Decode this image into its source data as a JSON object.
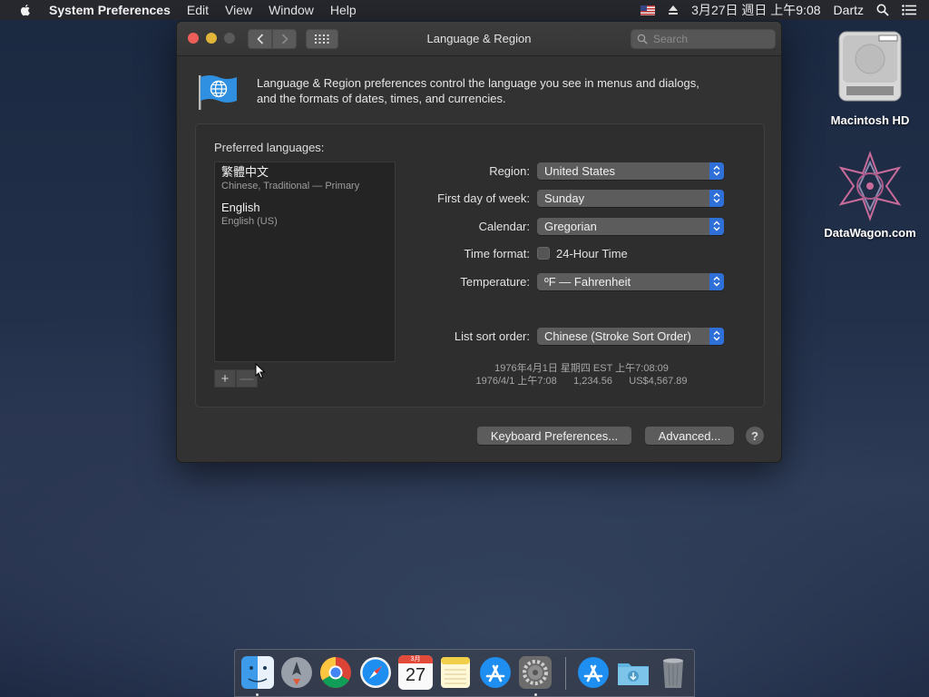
{
  "menubar": {
    "app_name": "System Preferences",
    "menus": [
      "Edit",
      "View",
      "Window",
      "Help"
    ],
    "clock": "3月27日 週日 上午9:08",
    "user": "Dartz"
  },
  "window": {
    "title": "Language & Region",
    "search_placeholder": "Search",
    "description_line1": "Language & Region preferences control the language you see in menus and dialogs,",
    "description_line2": "and the formats of dates, times, and currencies."
  },
  "languages": {
    "label": "Preferred languages:",
    "items": [
      {
        "name": "繁體中文",
        "detail": "Chinese, Traditional — Primary"
      },
      {
        "name": "English",
        "detail": "English (US)"
      }
    ],
    "add_label": "+",
    "remove_label": "—"
  },
  "settings": {
    "region": {
      "label": "Region:",
      "value": "United States"
    },
    "first_day": {
      "label": "First day of week:",
      "value": "Sunday"
    },
    "calendar": {
      "label": "Calendar:",
      "value": "Gregorian"
    },
    "time_format": {
      "label": "Time format:",
      "checkbox_label": "24-Hour Time",
      "checked": false
    },
    "temperature": {
      "label": "Temperature:",
      "value": "ºF — Fahrenheit"
    },
    "list_sort": {
      "label": "List sort order:",
      "value": "Chinese (Stroke Sort Order)"
    }
  },
  "samples": {
    "line1": "1976年4月1日 星期四 EST 上午7:08:09",
    "line2": "1976/4/1 上午7:08      1,234.56      US$4,567.89"
  },
  "buttons": {
    "keyboard": "Keyboard Preferences...",
    "advanced": "Advanced...",
    "help": "?"
  },
  "desktop": {
    "icons": [
      {
        "label": "Macintosh HD"
      },
      {
        "label": "DataWagon.com"
      }
    ]
  },
  "dock": {
    "items": [
      "Finder",
      "Launchpad",
      "Chrome",
      "Safari",
      "Calendar",
      "Notes",
      "App Store",
      "System Preferences",
      "App Store Downloads",
      "Downloads",
      "Trash"
    ],
    "calendar_month": "3月",
    "calendar_day": "27"
  },
  "colors": {
    "accent": "#2f6fd8",
    "close": "#ec5f58",
    "minimize": "#e1b43a"
  }
}
